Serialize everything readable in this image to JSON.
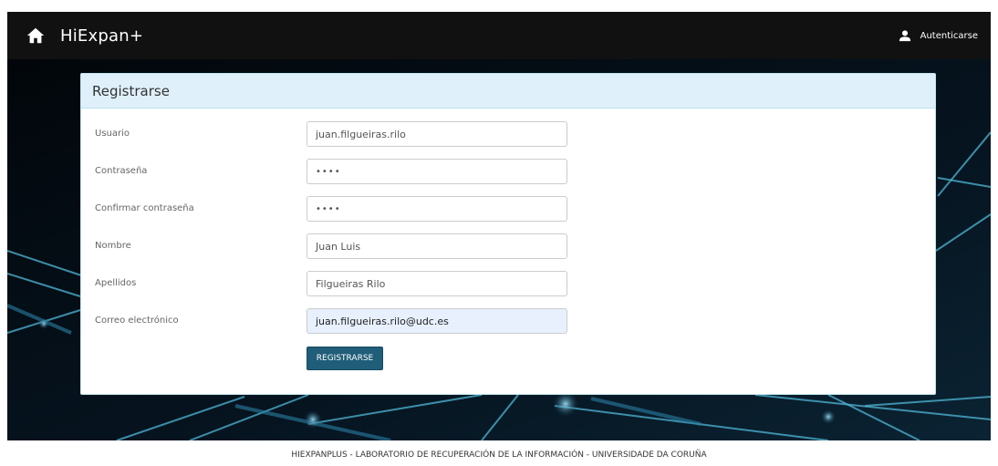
{
  "navbar": {
    "brand": "HiExpan+",
    "home_icon": "home-icon",
    "auth_label": "Autenticarse",
    "user_icon": "user-icon"
  },
  "panel": {
    "title": "Registrarse"
  },
  "form": {
    "fields": [
      {
        "label": "Usuario",
        "value": "juan.filgueiras.rilo"
      },
      {
        "label": "Contraseña",
        "value": "••••"
      },
      {
        "label": "Confirmar contraseña",
        "value": "••••"
      },
      {
        "label": "Nombre",
        "value": "Juan Luis"
      },
      {
        "label": "Apellidos",
        "value": "Filgueiras Rilo"
      },
      {
        "label": "Correo electrónico",
        "value": "juan.filgueiras.rilo@udc.es"
      }
    ],
    "submit_label": "REGISTRARSE"
  },
  "footer": {
    "text": "HIEXPANPLUS - LABORATORIO DE RECUPERACIÓN DE LA INFORMACIÓN - UNIVERSIDADE DA CORUÑA"
  },
  "colors": {
    "navbar_bg": "#111111",
    "panel_heading_bg": "#dff0fb",
    "button_bg": "#1f5d78",
    "autofill_bg": "#e8f0fe"
  }
}
